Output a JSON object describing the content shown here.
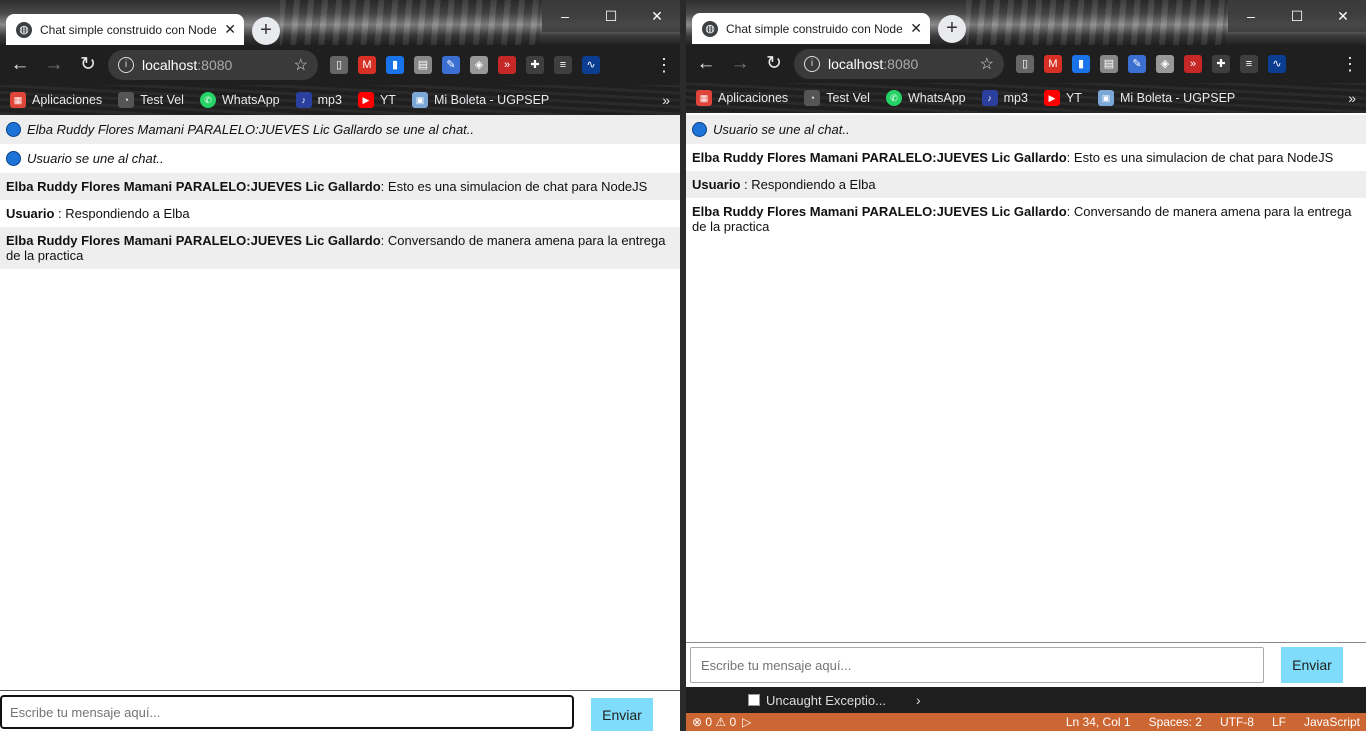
{
  "browser": {
    "tab_title": "Chat simple construido con NodeJS",
    "url_host": "localhost",
    "url_port": ":8080",
    "window_controls": [
      "–",
      "☐",
      "✕"
    ],
    "bookmarks": [
      {
        "label": "Aplicaciones",
        "icon": "apps-grid-icon",
        "color": "#e0453a"
      },
      {
        "label": "Test Vel",
        "icon": "speedometer-icon",
        "color": "#555555"
      },
      {
        "label": "WhatsApp",
        "icon": "whatsapp-icon",
        "color": "#25d366"
      },
      {
        "label": "mp3",
        "icon": "music-icon",
        "color": "#2a3f9e"
      },
      {
        "label": "YT",
        "icon": "youtube-icon",
        "color": "#ff0000"
      },
      {
        "label": "Mi Boleta - UGPSEP",
        "icon": "document-icon",
        "color": "#7aa7d6"
      }
    ],
    "more_bookmarks": "»"
  },
  "left_chat": {
    "messages": [
      {
        "type": "event",
        "text": "Elba Ruddy Flores Mamani PARALELO:JUEVES Lic Gallardo se une al chat.."
      },
      {
        "type": "event",
        "text": "Usuario se une al chat.."
      },
      {
        "type": "message",
        "user": "Elba Ruddy Flores Mamani PARALELO:JUEVES Lic Gallardo",
        "sep": ": ",
        "text": "Esto es una simulacion de chat para NodeJS"
      },
      {
        "type": "message",
        "user": "Usuario",
        "sep": " : ",
        "text": "Respondiendo a Elba"
      },
      {
        "type": "message",
        "user": "Elba Ruddy Flores Mamani PARALELO:JUEVES Lic Gallardo",
        "sep": ": ",
        "text": "Conversando de manera amena para la entrega de la practica"
      }
    ],
    "input_placeholder": "Escribe tu mensaje aquí...",
    "send_label": "Enviar"
  },
  "right_chat": {
    "messages": [
      {
        "type": "event",
        "text": "Usuario se une al chat.."
      },
      {
        "type": "message",
        "user": "Elba Ruddy Flores Mamani PARALELO:JUEVES Lic Gallardo",
        "sep": ": ",
        "text": "Esto es una simulacion de chat para NodeJS"
      },
      {
        "type": "message",
        "user": "Usuario",
        "sep": " : ",
        "text": "Respondiendo a Elba"
      },
      {
        "type": "message",
        "user": "Elba Ruddy Flores Mamani PARALELO:JUEVES Lic Gallardo",
        "sep": ": ",
        "text": "Conversando de manera amena para la entrega de la practica"
      }
    ],
    "input_placeholder": "Escribe tu mensaje aquí...",
    "send_label": "Enviar"
  },
  "editor": {
    "breakpoint_label": "Uncaught Exceptio...",
    "status_left": "⊗ 0 ⚠ 0",
    "status_items": [
      "Ln 34, Col 1",
      "Spaces: 2",
      "UTF-8",
      "LF",
      "JavaScript"
    ]
  }
}
